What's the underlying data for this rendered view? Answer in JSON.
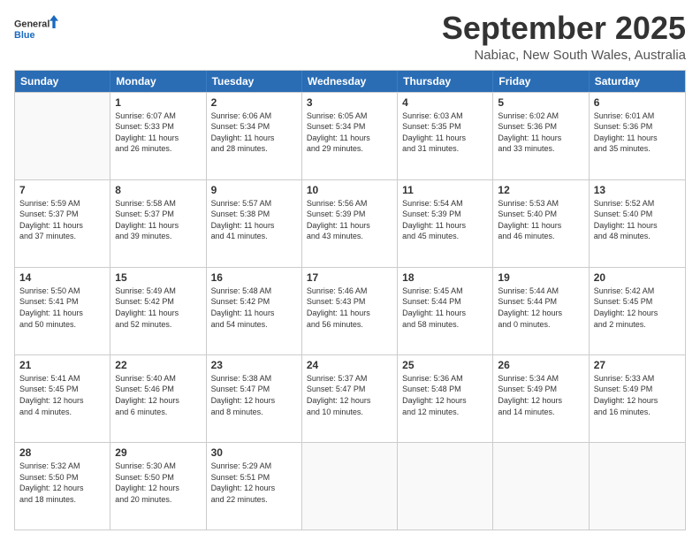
{
  "logo": {
    "line1": "General",
    "line2": "Blue"
  },
  "title": "September 2025",
  "location": "Nabiac, New South Wales, Australia",
  "days_of_week": [
    "Sunday",
    "Monday",
    "Tuesday",
    "Wednesday",
    "Thursday",
    "Friday",
    "Saturday"
  ],
  "weeks": [
    [
      {
        "day": "",
        "info": ""
      },
      {
        "day": "1",
        "info": "Sunrise: 6:07 AM\nSunset: 5:33 PM\nDaylight: 11 hours\nand 26 minutes."
      },
      {
        "day": "2",
        "info": "Sunrise: 6:06 AM\nSunset: 5:34 PM\nDaylight: 11 hours\nand 28 minutes."
      },
      {
        "day": "3",
        "info": "Sunrise: 6:05 AM\nSunset: 5:34 PM\nDaylight: 11 hours\nand 29 minutes."
      },
      {
        "day": "4",
        "info": "Sunrise: 6:03 AM\nSunset: 5:35 PM\nDaylight: 11 hours\nand 31 minutes."
      },
      {
        "day": "5",
        "info": "Sunrise: 6:02 AM\nSunset: 5:36 PM\nDaylight: 11 hours\nand 33 minutes."
      },
      {
        "day": "6",
        "info": "Sunrise: 6:01 AM\nSunset: 5:36 PM\nDaylight: 11 hours\nand 35 minutes."
      }
    ],
    [
      {
        "day": "7",
        "info": "Sunrise: 5:59 AM\nSunset: 5:37 PM\nDaylight: 11 hours\nand 37 minutes."
      },
      {
        "day": "8",
        "info": "Sunrise: 5:58 AM\nSunset: 5:37 PM\nDaylight: 11 hours\nand 39 minutes."
      },
      {
        "day": "9",
        "info": "Sunrise: 5:57 AM\nSunset: 5:38 PM\nDaylight: 11 hours\nand 41 minutes."
      },
      {
        "day": "10",
        "info": "Sunrise: 5:56 AM\nSunset: 5:39 PM\nDaylight: 11 hours\nand 43 minutes."
      },
      {
        "day": "11",
        "info": "Sunrise: 5:54 AM\nSunset: 5:39 PM\nDaylight: 11 hours\nand 45 minutes."
      },
      {
        "day": "12",
        "info": "Sunrise: 5:53 AM\nSunset: 5:40 PM\nDaylight: 11 hours\nand 46 minutes."
      },
      {
        "day": "13",
        "info": "Sunrise: 5:52 AM\nSunset: 5:40 PM\nDaylight: 11 hours\nand 48 minutes."
      }
    ],
    [
      {
        "day": "14",
        "info": "Sunrise: 5:50 AM\nSunset: 5:41 PM\nDaylight: 11 hours\nand 50 minutes."
      },
      {
        "day": "15",
        "info": "Sunrise: 5:49 AM\nSunset: 5:42 PM\nDaylight: 11 hours\nand 52 minutes."
      },
      {
        "day": "16",
        "info": "Sunrise: 5:48 AM\nSunset: 5:42 PM\nDaylight: 11 hours\nand 54 minutes."
      },
      {
        "day": "17",
        "info": "Sunrise: 5:46 AM\nSunset: 5:43 PM\nDaylight: 11 hours\nand 56 minutes."
      },
      {
        "day": "18",
        "info": "Sunrise: 5:45 AM\nSunset: 5:44 PM\nDaylight: 11 hours\nand 58 minutes."
      },
      {
        "day": "19",
        "info": "Sunrise: 5:44 AM\nSunset: 5:44 PM\nDaylight: 12 hours\nand 0 minutes."
      },
      {
        "day": "20",
        "info": "Sunrise: 5:42 AM\nSunset: 5:45 PM\nDaylight: 12 hours\nand 2 minutes."
      }
    ],
    [
      {
        "day": "21",
        "info": "Sunrise: 5:41 AM\nSunset: 5:45 PM\nDaylight: 12 hours\nand 4 minutes."
      },
      {
        "day": "22",
        "info": "Sunrise: 5:40 AM\nSunset: 5:46 PM\nDaylight: 12 hours\nand 6 minutes."
      },
      {
        "day": "23",
        "info": "Sunrise: 5:38 AM\nSunset: 5:47 PM\nDaylight: 12 hours\nand 8 minutes."
      },
      {
        "day": "24",
        "info": "Sunrise: 5:37 AM\nSunset: 5:47 PM\nDaylight: 12 hours\nand 10 minutes."
      },
      {
        "day": "25",
        "info": "Sunrise: 5:36 AM\nSunset: 5:48 PM\nDaylight: 12 hours\nand 12 minutes."
      },
      {
        "day": "26",
        "info": "Sunrise: 5:34 AM\nSunset: 5:49 PM\nDaylight: 12 hours\nand 14 minutes."
      },
      {
        "day": "27",
        "info": "Sunrise: 5:33 AM\nSunset: 5:49 PM\nDaylight: 12 hours\nand 16 minutes."
      }
    ],
    [
      {
        "day": "28",
        "info": "Sunrise: 5:32 AM\nSunset: 5:50 PM\nDaylight: 12 hours\nand 18 minutes."
      },
      {
        "day": "29",
        "info": "Sunrise: 5:30 AM\nSunset: 5:50 PM\nDaylight: 12 hours\nand 20 minutes."
      },
      {
        "day": "30",
        "info": "Sunrise: 5:29 AM\nSunset: 5:51 PM\nDaylight: 12 hours\nand 22 minutes."
      },
      {
        "day": "",
        "info": ""
      },
      {
        "day": "",
        "info": ""
      },
      {
        "day": "",
        "info": ""
      },
      {
        "day": "",
        "info": ""
      }
    ]
  ]
}
